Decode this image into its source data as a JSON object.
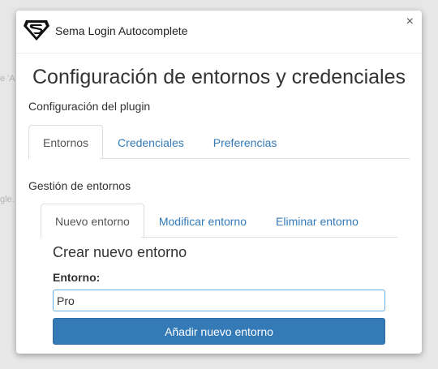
{
  "background": {
    "fragment_1": "e 'A",
    "fragment_2": "gle."
  },
  "header": {
    "logo_icon": "superman-logo-icon",
    "title": "Sema Login Autocomplete",
    "close_label": "×"
  },
  "page_title": "Configuración de entornos y credenciales",
  "plugin_section": {
    "label": "Configuración del plugin",
    "tabs": [
      {
        "label": "Entornos",
        "active": true
      },
      {
        "label": "Credenciales",
        "active": false
      },
      {
        "label": "Preferencias",
        "active": false
      }
    ]
  },
  "env_section": {
    "label": "Gestión de entornos",
    "tabs": [
      {
        "label": "Nuevo entorno",
        "active": true
      },
      {
        "label": "Modificar entorno",
        "active": false
      },
      {
        "label": "Eliminar entorno",
        "active": false
      }
    ]
  },
  "form": {
    "heading": "Crear nuevo entorno",
    "field_label": "Entorno:",
    "field_value": "Pro",
    "submit_label": "Añadir nuevo entorno"
  },
  "colors": {
    "link": "#337ab7",
    "primary_button": "#337ab7",
    "input_focus_border": "#66afe9"
  }
}
